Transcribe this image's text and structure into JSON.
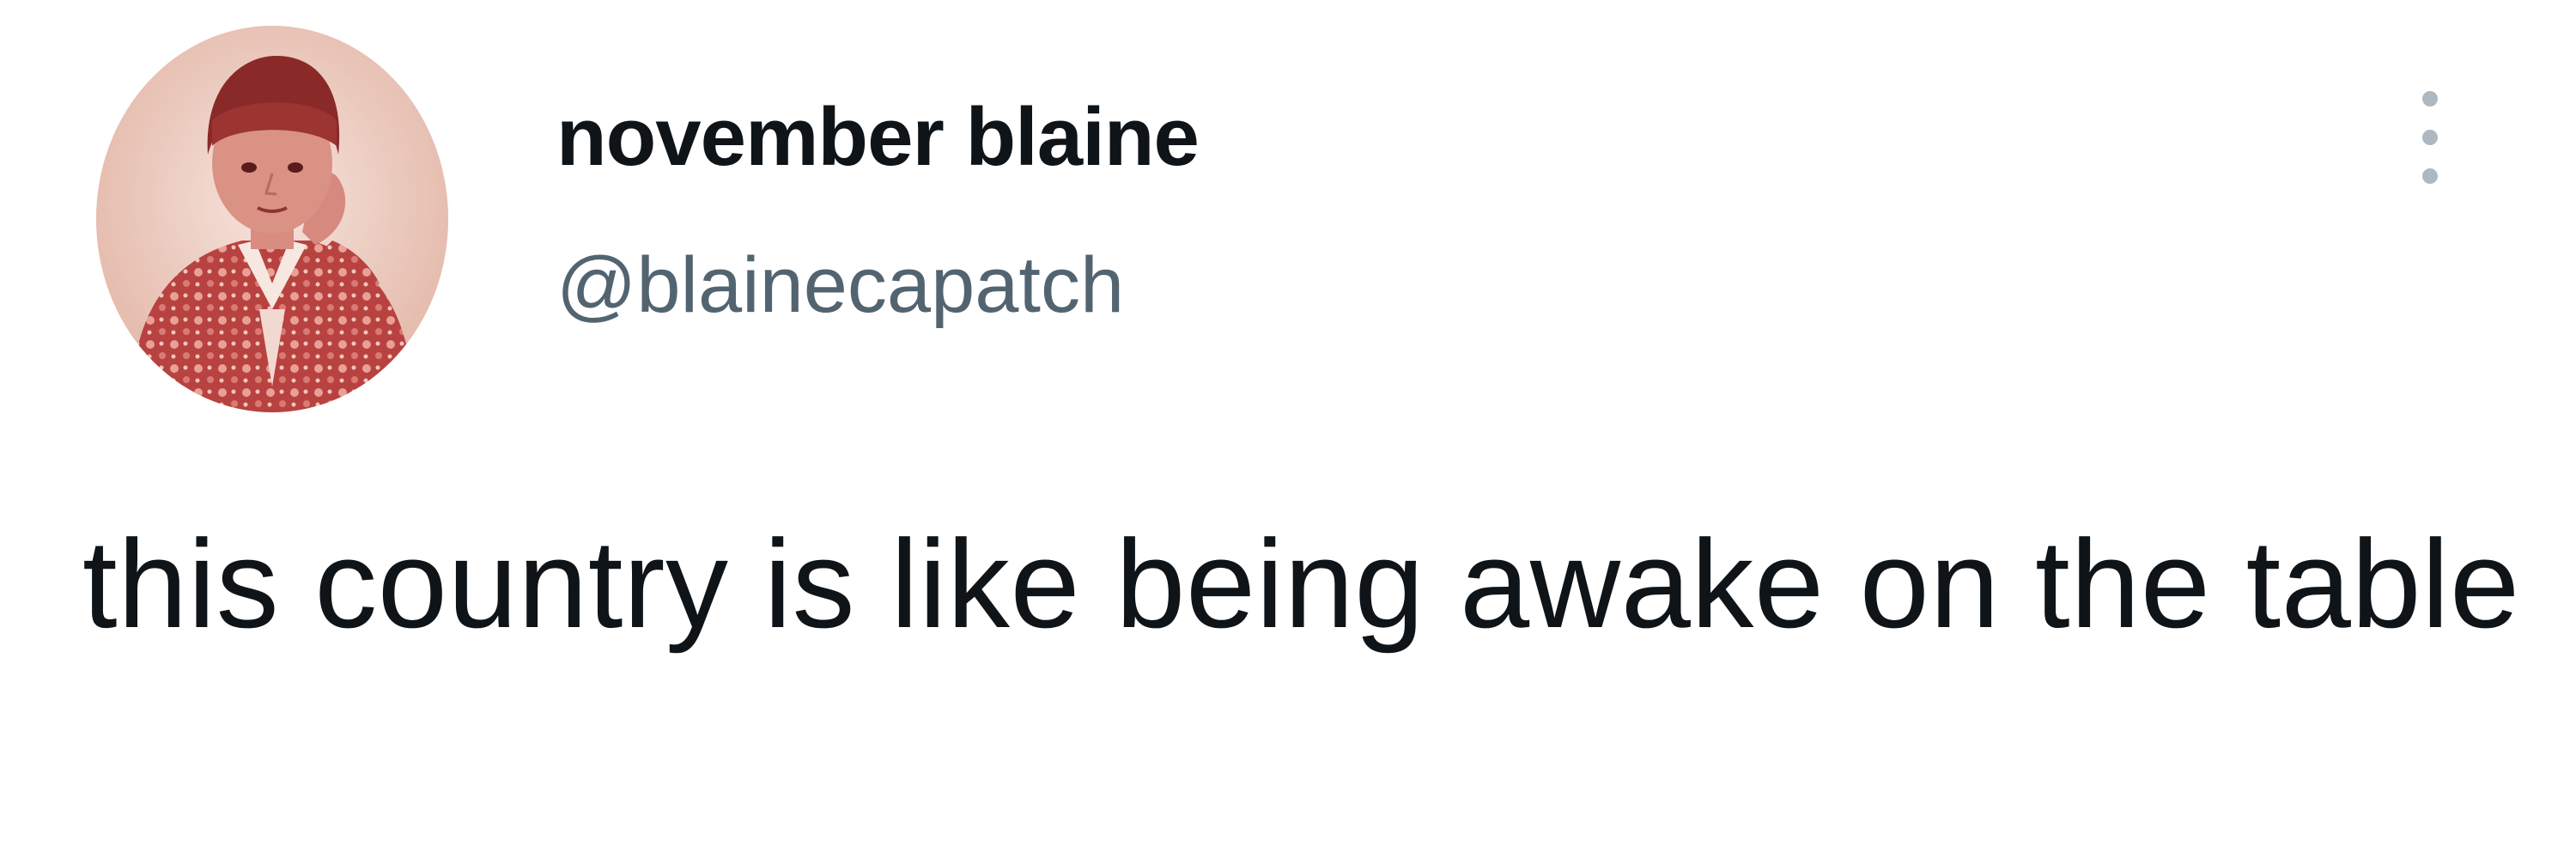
{
  "author": {
    "display_name": "november blaine",
    "handle": "@blainecapatch",
    "avatar_desc": "profile-photo"
  },
  "tweet": {
    "text": "this country is like being awake on the table"
  },
  "menu": {
    "icon": "more-options-icon"
  },
  "colors": {
    "name": "#0f1419",
    "handle": "#536471",
    "menu_dots": "#aeb8c0",
    "avatar_tint": "#c0504d"
  }
}
